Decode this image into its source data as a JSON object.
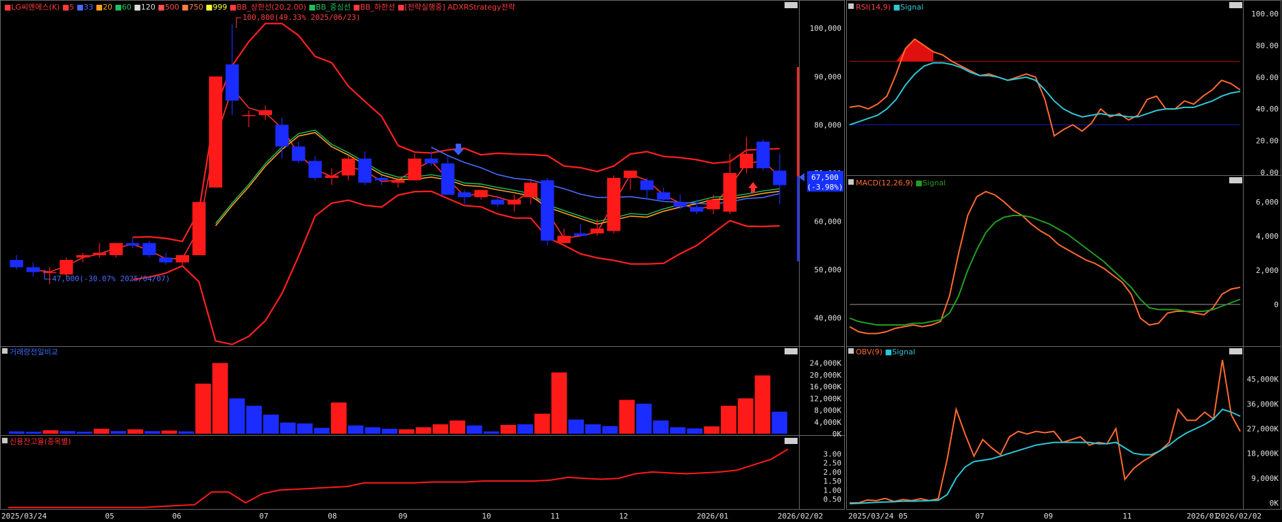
{
  "main_panel": {
    "legend": [
      {
        "text": "LG씨엔에스(K)",
        "color": "#ff3b3b"
      },
      {
        "text": "5",
        "color": "#ff3b3b"
      },
      {
        "text": "33",
        "color": "#4a6bff"
      },
      {
        "text": "20",
        "color": "#ffa020"
      },
      {
        "text": "60",
        "color": "#20c060"
      },
      {
        "text": "120",
        "color": "#e0e0e0"
      },
      {
        "text": "500",
        "color": "#ff5050"
      },
      {
        "text": "750",
        "color": "#ff8040"
      },
      {
        "text": "999",
        "color": "#ffff40"
      },
      {
        "text": "BB_상한선(20,2.00)",
        "color": "#ff3b3b"
      },
      {
        "text": "BB_중심선",
        "color": "#20c060"
      },
      {
        "text": "BB_하한선",
        "color": "#ff3b3b"
      },
      {
        "text": "[전략실행중] ADXRStrategy전략",
        "color": "#ff3b3b"
      }
    ],
    "high_annotation": "100,800(49.33% 2025/06/23)",
    "low_annotation": "47,000(-30.07% 2025/04/07)",
    "price_tag": {
      "price": "67,500",
      "change": "(-3.98%)"
    },
    "y_ticks": [
      "100,000",
      "90,000",
      "80,000",
      "70,000",
      "60,000",
      "50,000",
      "40,000"
    ]
  },
  "volume_panel": {
    "title": "거래량전일비교",
    "y_ticks": [
      "24,000K",
      "20,000K",
      "16,000K",
      "12,000K",
      "8,000K",
      "4,000K",
      "0K"
    ]
  },
  "credit_panel": {
    "title": "신용잔고율(종목별)",
    "y_ticks": [
      "3.00",
      "2.50",
      "2.00",
      "1.50",
      "1.00",
      "0.50"
    ]
  },
  "rsi_panel": {
    "title": "RSI(14,9)",
    "signal_label": "Signal",
    "y_ticks": [
      "100.00",
      "80.00",
      "60.00",
      "40.00",
      "20.00",
      "0.00"
    ]
  },
  "macd_panel": {
    "title": "MACD(12,26,9)",
    "signal_label": "Signal",
    "y_ticks": [
      "6,000",
      "4,000",
      "2,000",
      "0"
    ]
  },
  "obv_panel": {
    "title": "OBV(9)",
    "signal_label": "Signal",
    "y_ticks": [
      "45,000K",
      "36,000K",
      "27,000K",
      "18,000K",
      "9,000K",
      "0K"
    ]
  },
  "x_axis_left": [
    "2025/03/24",
    "05",
    "06",
    "07",
    "08",
    "09",
    "10",
    "11",
    "12",
    "2026/01",
    "2026/02/02"
  ],
  "x_axis_right": [
    "2025/03/24",
    "05",
    "07",
    "09",
    "11",
    "2026/01",
    "2026/02/02"
  ],
  "chart_data": [
    {
      "type": "candlestick",
      "title": "LG씨엔에스(K)",
      "ylim": [
        35000,
        103000
      ],
      "candles": [
        {
          "o": 52000,
          "h": 53000,
          "l": 50000,
          "c": 50500
        },
        {
          "o": 50500,
          "h": 51500,
          "l": 48500,
          "c": 49500
        },
        {
          "o": 49500,
          "h": 50500,
          "l": 47000,
          "c": 49500
        },
        {
          "o": 49000,
          "h": 52500,
          "l": 48500,
          "c": 52000
        },
        {
          "o": 52500,
          "h": 53500,
          "l": 51500,
          "c": 53000
        },
        {
          "o": 53000,
          "h": 55500,
          "l": 52500,
          "c": 53500
        },
        {
          "o": 53000,
          "h": 55500,
          "l": 52500,
          "c": 55500
        },
        {
          "o": 55500,
          "h": 56500,
          "l": 54500,
          "c": 55000
        },
        {
          "o": 55500,
          "h": 56000,
          "l": 52500,
          "c": 53000
        },
        {
          "o": 52500,
          "h": 53500,
          "l": 51000,
          "c": 51500
        },
        {
          "o": 51500,
          "h": 53000,
          "l": 51000,
          "c": 53000
        },
        {
          "o": 53000,
          "h": 64000,
          "l": 53000,
          "c": 64000
        },
        {
          "o": 67000,
          "h": 90000,
          "l": 67000,
          "c": 90000
        },
        {
          "o": 92500,
          "h": 100800,
          "l": 82000,
          "c": 85000
        },
        {
          "o": 82000,
          "h": 83000,
          "l": 79500,
          "c": 82000
        },
        {
          "o": 82000,
          "h": 84000,
          "l": 81000,
          "c": 83000
        },
        {
          "o": 80000,
          "h": 81500,
          "l": 73000,
          "c": 75500
        },
        {
          "o": 75500,
          "h": 76500,
          "l": 72000,
          "c": 72500
        },
        {
          "o": 72500,
          "h": 73500,
          "l": 68500,
          "c": 69000
        },
        {
          "o": 69000,
          "h": 71000,
          "l": 67500,
          "c": 69500
        },
        {
          "o": 69500,
          "h": 73500,
          "l": 68500,
          "c": 73000
        },
        {
          "o": 73000,
          "h": 74500,
          "l": 67500,
          "c": 68000
        },
        {
          "o": 69000,
          "h": 69500,
          "l": 67500,
          "c": 68500
        },
        {
          "o": 68000,
          "h": 69000,
          "l": 67000,
          "c": 68500
        },
        {
          "o": 68500,
          "h": 74000,
          "l": 68500,
          "c": 73000
        },
        {
          "o": 73000,
          "h": 74500,
          "l": 71500,
          "c": 72000
        },
        {
          "o": 72000,
          "h": 73500,
          "l": 65500,
          "c": 65500
        },
        {
          "o": 66000,
          "h": 66500,
          "l": 63500,
          "c": 65000
        },
        {
          "o": 65000,
          "h": 66500,
          "l": 64500,
          "c": 66500
        },
        {
          "o": 64500,
          "h": 65000,
          "l": 63000,
          "c": 63500
        },
        {
          "o": 63500,
          "h": 65500,
          "l": 62000,
          "c": 64500
        },
        {
          "o": 65000,
          "h": 68500,
          "l": 63500,
          "c": 68000
        },
        {
          "o": 68500,
          "h": 69000,
          "l": 55000,
          "c": 56000
        },
        {
          "o": 55500,
          "h": 58500,
          "l": 55500,
          "c": 57000
        },
        {
          "o": 57500,
          "h": 59500,
          "l": 57000,
          "c": 57000
        },
        {
          "o": 57500,
          "h": 60500,
          "l": 57000,
          "c": 58500
        },
        {
          "o": 58000,
          "h": 69500,
          "l": 57500,
          "c": 69000
        },
        {
          "o": 69000,
          "h": 70500,
          "l": 66500,
          "c": 70500
        },
        {
          "o": 68500,
          "h": 69000,
          "l": 64500,
          "c": 66500
        },
        {
          "o": 66000,
          "h": 67000,
          "l": 64000,
          "c": 64500
        },
        {
          "o": 64000,
          "h": 65500,
          "l": 62500,
          "c": 63000
        },
        {
          "o": 63000,
          "h": 64500,
          "l": 61500,
          "c": 62000
        },
        {
          "o": 62500,
          "h": 65500,
          "l": 61500,
          "c": 64500
        },
        {
          "o": 62000,
          "h": 74000,
          "l": 61500,
          "c": 70000
        },
        {
          "o": 71000,
          "h": 77500,
          "l": 70000,
          "c": 74000
        },
        {
          "o": 76500,
          "h": 77000,
          "l": 70500,
          "c": 71000
        },
        {
          "o": 70500,
          "h": 74000,
          "l": 63500,
          "c": 67500
        }
      ]
    },
    {
      "type": "bar",
      "title": "거래량전일비교",
      "ylim": [
        0,
        26000
      ],
      "values": [
        800,
        700,
        1200,
        900,
        700,
        1700,
        900,
        1500,
        900,
        1100,
        800,
        17000,
        24000,
        12000,
        9500,
        6500,
        3800,
        3500,
        2000,
        10600,
        2800,
        2200,
        1700,
        1500,
        2200,
        3200,
        4500,
        2800,
        800,
        3000,
        3200,
        6800,
        20800,
        4800,
        3200,
        2600,
        11500,
        10200,
        4500,
        2200,
        1800,
        2500,
        9500,
        12000,
        19800,
        7500
      ],
      "colors": [
        "b",
        "b",
        "r",
        "b",
        "b",
        "r",
        "b",
        "r",
        "b",
        "r",
        "b",
        "r",
        "r",
        "b",
        "b",
        "b",
        "b",
        "b",
        "b",
        "r",
        "b",
        "b",
        "b",
        "r",
        "r",
        "r",
        "r",
        "b",
        "b",
        "r",
        "b",
        "r",
        "r",
        "b",
        "b",
        "b",
        "r",
        "b",
        "b",
        "b",
        "b",
        "r",
        "r",
        "r",
        "r",
        "b"
      ]
    },
    {
      "type": "line",
      "title": "신용잔고율(종목별)",
      "ylim": [
        0,
        3.5
      ],
      "values": [
        0.05,
        0.05,
        0.05,
        0.05,
        0.05,
        0.05,
        0.05,
        0.05,
        0.05,
        0.1,
        0.15,
        0.2,
        0.9,
        0.9,
        0.3,
        0.8,
        1.0,
        1.05,
        1.1,
        1.15,
        1.2,
        1.4,
        1.4,
        1.4,
        1.4,
        1.45,
        1.45,
        1.45,
        1.5,
        1.5,
        1.5,
        1.5,
        1.55,
        1.7,
        1.65,
        1.6,
        1.65,
        1.9,
        2.0,
        1.95,
        1.9,
        1.95,
        2.0,
        2.1,
        2.4,
        2.7,
        3.25
      ]
    },
    {
      "type": "line",
      "title": "RSI(14,9)",
      "ylim": [
        0,
        100
      ],
      "series": [
        {
          "name": "RSI",
          "values": [
            41,
            42,
            40,
            43,
            48,
            62,
            78,
            84,
            80,
            76,
            74,
            70,
            67,
            64,
            61,
            62,
            60,
            58,
            60,
            62,
            60,
            46,
            23,
            27,
            30,
            26,
            31,
            40,
            35,
            37,
            33,
            36,
            46,
            48,
            40,
            40,
            45,
            43,
            48,
            52,
            58,
            56,
            52
          ]
        },
        {
          "name": "Signal",
          "values": [
            30,
            32,
            34,
            36,
            40,
            46,
            55,
            62,
            67,
            69,
            69,
            68,
            66,
            63,
            61,
            61,
            60,
            58,
            59,
            60,
            58,
            52,
            45,
            40,
            37,
            35,
            36,
            37,
            36,
            36,
            35,
            35,
            37,
            39,
            40,
            40,
            41,
            41,
            43,
            45,
            48,
            50,
            51
          ]
        }
      ]
    },
    {
      "type": "line",
      "title": "MACD(12,26,9)",
      "ylim": [
        -2200,
        7000
      ],
      "series": [
        {
          "name": "MACD",
          "values": [
            -1300,
            -1600,
            -1700,
            -1700,
            -1600,
            -1400,
            -1300,
            -1200,
            -1300,
            -1200,
            -1000,
            500,
            3000,
            5200,
            6300,
            6600,
            6400,
            6000,
            5500,
            5200,
            4700,
            4300,
            4000,
            3500,
            3200,
            2900,
            2600,
            2400,
            2100,
            1700,
            1300,
            600,
            -800,
            -1200,
            -1100,
            -500,
            -400,
            -400,
            -500,
            -600,
            -200,
            600,
            900,
            1000
          ]
        },
        {
          "name": "Signal",
          "values": [
            -800,
            -1000,
            -1100,
            -1200,
            -1200,
            -1200,
            -1200,
            -1100,
            -1100,
            -1000,
            -900,
            -500,
            500,
            2000,
            3200,
            4200,
            4800,
            5100,
            5200,
            5200,
            5100,
            4900,
            4700,
            4400,
            4100,
            3700,
            3300,
            2900,
            2500,
            2000,
            1500,
            1000,
            300,
            -200,
            -300,
            -300,
            -300,
            -400,
            -400,
            -400,
            -300,
            -100,
            100,
            300
          ]
        }
      ]
    },
    {
      "type": "line",
      "title": "OBV(9)",
      "ylim": [
        -2000,
        53000
      ],
      "series": [
        {
          "name": "OBV",
          "values": [
            0,
            0,
            1000,
            800,
            1600,
            500,
            1200,
            800,
            1500,
            800,
            1500,
            16000,
            34000,
            25000,
            17000,
            23000,
            20000,
            17500,
            24000,
            26000,
            25000,
            26000,
            25500,
            26000,
            22000,
            23000,
            24000,
            21000,
            22000,
            21500,
            27000,
            8500,
            12500,
            15000,
            17000,
            19000,
            22000,
            34000,
            30000,
            30000,
            33000,
            30500,
            52000,
            32000,
            26000
          ]
        },
        {
          "name": "Signal",
          "values": [
            -300,
            -200,
            0,
            200,
            300,
            400,
            600,
            600,
            700,
            800,
            900,
            3000,
            9000,
            13000,
            15000,
            15500,
            16000,
            17000,
            18000,
            19000,
            20000,
            21000,
            21500,
            22000,
            22000,
            22000,
            22000,
            22000,
            21500,
            21500,
            22000,
            20000,
            18000,
            17500,
            17500,
            19000,
            21000,
            23500,
            25500,
            27000,
            28500,
            30500,
            34000,
            33000,
            31500
          ]
        }
      ]
    }
  ]
}
